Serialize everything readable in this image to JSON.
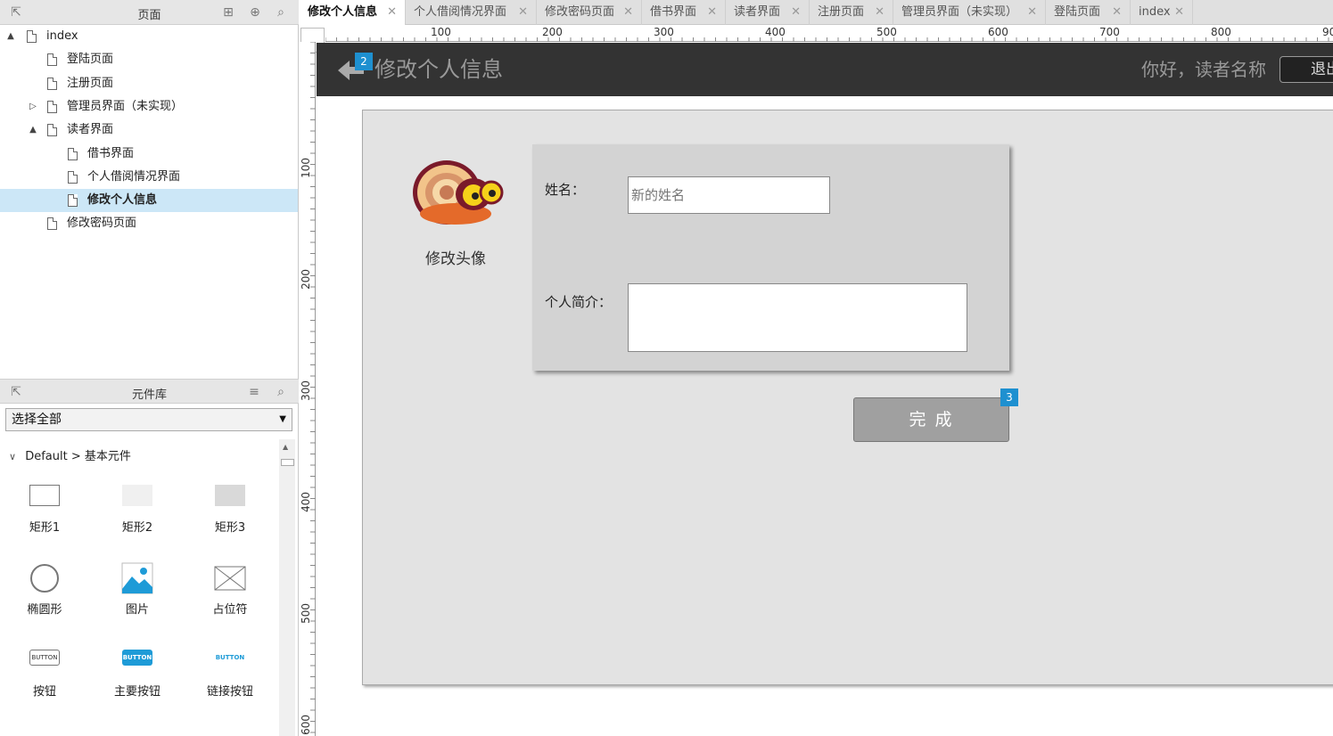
{
  "pages_panel": {
    "title": "页面",
    "items": [
      {
        "label": "index",
        "toggle": "▲",
        "selected": false
      },
      {
        "label": "登陆页面",
        "toggle": "",
        "selected": false
      },
      {
        "label": "注册页面",
        "toggle": "",
        "selected": false
      },
      {
        "label": "管理员界面（未实现）",
        "toggle": "▷",
        "selected": false
      },
      {
        "label": "读者界面",
        "toggle": "▲",
        "selected": false
      },
      {
        "label": "借书界面",
        "toggle": "",
        "selected": false
      },
      {
        "label": "个人借阅情况界面",
        "toggle": "",
        "selected": false
      },
      {
        "label": "修改个人信息",
        "toggle": "",
        "selected": true
      },
      {
        "label": "修改密码页面",
        "toggle": "",
        "selected": false
      }
    ]
  },
  "library_panel": {
    "title": "元件库",
    "select_value": "选择全部",
    "group": "Default > 基本元件",
    "widgets": [
      "矩形1",
      "矩形2",
      "矩形3",
      "椭圆形",
      "图片",
      "占位符",
      "按钮",
      "主要按钮",
      "链接按钮"
    ],
    "button_icon_text": "BUTTON"
  },
  "tabs": [
    {
      "label": "修改个人信息",
      "active": true
    },
    {
      "label": "个人借阅情况界面",
      "active": false
    },
    {
      "label": "修改密码页面",
      "active": false
    },
    {
      "label": "借书界面",
      "active": false
    },
    {
      "label": "读者界面",
      "active": false
    },
    {
      "label": "注册页面",
      "active": false
    },
    {
      "label": "管理员界面（未实现）",
      "active": false
    },
    {
      "label": "登陆页面",
      "active": false
    },
    {
      "label": "index",
      "active": false
    }
  ],
  "ruler": {
    "top": [
      "100",
      "200",
      "300",
      "400",
      "500",
      "600",
      "700",
      "800",
      "90"
    ],
    "left": [
      "100",
      "200",
      "300",
      "400",
      "500",
      "600"
    ]
  },
  "canvas": {
    "page_title": "修改个人信息",
    "greeting": "你好，读者名称",
    "logout_label": "退出",
    "marker_back": "2",
    "marker_done": "3",
    "avatar_label": "修改头像",
    "name_label": "姓名：",
    "name_placeholder": "新的姓名",
    "bio_label": "个人简介：",
    "done_label": "完 成"
  },
  "colors": {
    "header_bg": "#333333",
    "selected_row": "#cce7f7",
    "marker": "#1e90d0",
    "content_bg": "#e3e3e3",
    "form_bg": "#d3d3d3"
  }
}
